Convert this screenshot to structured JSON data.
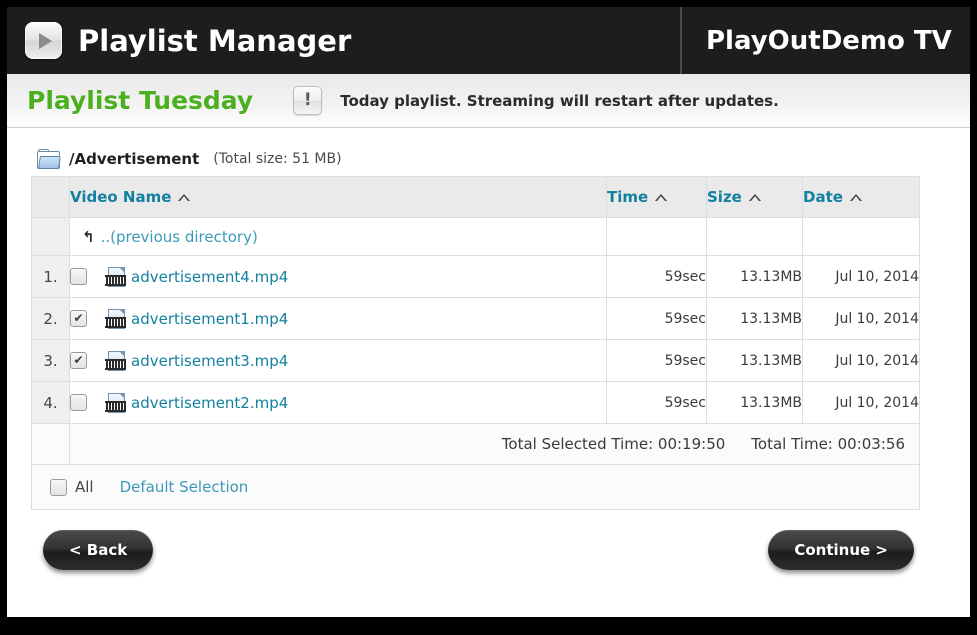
{
  "header": {
    "app_title": "Playlist Manager",
    "channel_title": "PlayOutDemo TV",
    "play_icon": "play-icon"
  },
  "subheader": {
    "playlist_name": "Playlist Tuesday",
    "warn_icon_glyph": "!",
    "notice": "Today playlist. Streaming will restart after updates."
  },
  "path": {
    "folder_icon": "folder-icon",
    "current": "/Advertisement",
    "total_size": "(Total size: 51 MB)"
  },
  "table": {
    "columns": {
      "name": "Video Name",
      "time": "Time",
      "size": "Size",
      "date": "Date"
    },
    "up_row": {
      "arrow": "↰",
      "label": "..(previous directory)"
    },
    "rows": [
      {
        "num": "1.",
        "checked": false,
        "name": "advertisement4.mp4",
        "time": "59sec",
        "size": "13.13MB",
        "date": "Jul 10, 2014"
      },
      {
        "num": "2.",
        "checked": true,
        "name": "advertisement1.mp4",
        "time": "59sec",
        "size": "13.13MB",
        "date": "Jul 10, 2014"
      },
      {
        "num": "3.",
        "checked": true,
        "name": "advertisement3.mp4",
        "time": "59sec",
        "size": "13.13MB",
        "date": "Jul 10, 2014"
      },
      {
        "num": "4.",
        "checked": false,
        "name": "advertisement2.mp4",
        "time": "59sec",
        "size": "13.13MB",
        "date": "Jul 10, 2014"
      }
    ],
    "totals": {
      "selected_time": "Total Selected Time: 00:19:50",
      "total_time": "Total Time: 00:03:56"
    },
    "footer": {
      "all_label": "All",
      "all_checked": false,
      "default_selection": "Default Selection"
    }
  },
  "buttons": {
    "back": "< Back",
    "continue": "Continue >"
  },
  "colors": {
    "accent_link": "#1480a0",
    "playlist_green": "#4caf20",
    "topbar_bg": "#1d1d1d",
    "frame": "#000000"
  }
}
